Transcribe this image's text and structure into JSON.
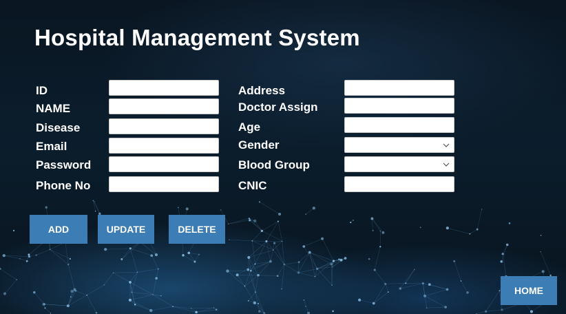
{
  "app": {
    "title": "Hospital Management System"
  },
  "form": {
    "left": [
      {
        "key": "id",
        "label": "ID",
        "value": ""
      },
      {
        "key": "name",
        "label": "NAME",
        "value": ""
      },
      {
        "key": "disease",
        "label": "Disease",
        "value": ""
      },
      {
        "key": "email",
        "label": "Email",
        "value": ""
      },
      {
        "key": "password",
        "label": "Password",
        "value": ""
      },
      {
        "key": "phone",
        "label": "Phone No",
        "value": ""
      }
    ],
    "right": [
      {
        "key": "address",
        "label": "Address",
        "value": ""
      },
      {
        "key": "doctor_assign",
        "label": "Doctor Assign",
        "value": ""
      },
      {
        "key": "age",
        "label": "Age",
        "value": ""
      },
      {
        "key": "gender",
        "label": "Gender",
        "value": "",
        "type": "select",
        "icon": "chevron-down-icon"
      },
      {
        "key": "blood_group",
        "label": "Blood Group",
        "value": "",
        "type": "select",
        "icon": "chevron-down-icon"
      },
      {
        "key": "cnic",
        "label": "CNIC",
        "value": ""
      }
    ]
  },
  "buttons": {
    "add": "ADD",
    "update": "UPDATE",
    "delete": "DELETE",
    "home": "HOME"
  },
  "colors": {
    "button_bg": "#3d7db5",
    "background": "#0a1622",
    "text": "#ffffff"
  }
}
